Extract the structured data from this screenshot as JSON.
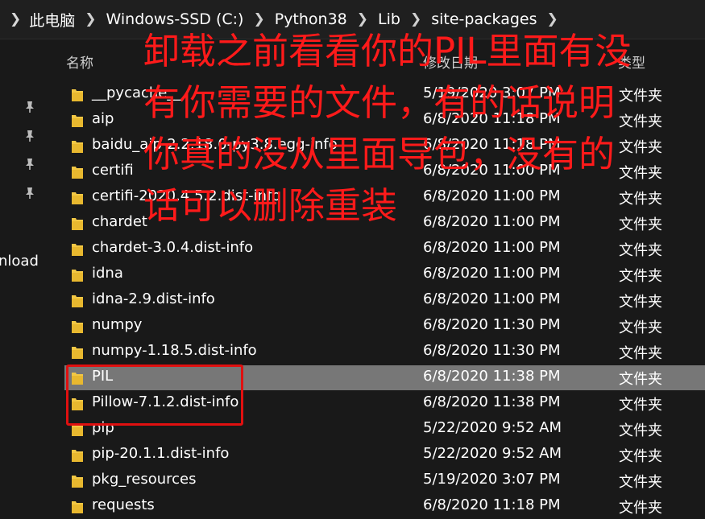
{
  "breadcrumb": {
    "items": [
      "此电脑",
      "Windows-SSD (C:)",
      "Python38",
      "Lib",
      "site-packages"
    ]
  },
  "columns": {
    "name": "名称",
    "modified": "修改日期",
    "type": "类型"
  },
  "nav": {
    "label": "nload"
  },
  "files": [
    {
      "name": "__pycache__",
      "date": "5/19/2020 3:07 PM",
      "type": "文件夹"
    },
    {
      "name": "aip",
      "date": "6/8/2020 11:18 PM",
      "type": "文件夹"
    },
    {
      "name": "baidu_aip-2.2.18.0-py3.8.egg-info",
      "date": "6/8/2020 11:18 PM",
      "type": "文件夹"
    },
    {
      "name": "certifi",
      "date": "6/8/2020 11:00 PM",
      "type": "文件夹"
    },
    {
      "name": "certifi-2020.4.5.2.dist-info",
      "date": "6/8/2020 11:00 PM",
      "type": "文件夹"
    },
    {
      "name": "chardet",
      "date": "6/8/2020 11:00 PM",
      "type": "文件夹"
    },
    {
      "name": "chardet-3.0.4.dist-info",
      "date": "6/8/2020 11:00 PM",
      "type": "文件夹"
    },
    {
      "name": "idna",
      "date": "6/8/2020 11:00 PM",
      "type": "文件夹"
    },
    {
      "name": "idna-2.9.dist-info",
      "date": "6/8/2020 11:00 PM",
      "type": "文件夹"
    },
    {
      "name": "numpy",
      "date": "6/8/2020 11:30 PM",
      "type": "文件夹"
    },
    {
      "name": "numpy-1.18.5.dist-info",
      "date": "6/8/2020 11:30 PM",
      "type": "文件夹"
    },
    {
      "name": "PIL",
      "date": "6/8/2020 11:38 PM",
      "type": "文件夹",
      "selected": true
    },
    {
      "name": "Pillow-7.1.2.dist-info",
      "date": "6/8/2020 11:38 PM",
      "type": "文件夹"
    },
    {
      "name": "pip",
      "date": "5/22/2020 9:52 AM",
      "type": "文件夹"
    },
    {
      "name": "pip-20.1.1.dist-info",
      "date": "5/22/2020 9:52 AM",
      "type": "文件夹"
    },
    {
      "name": "pkg_resources",
      "date": "5/19/2020 3:07 PM",
      "type": "文件夹"
    },
    {
      "name": "requests",
      "date": "6/8/2020 11:18 PM",
      "type": "文件夹"
    }
  ],
  "annotation": {
    "lines": [
      "卸载之前看看你的PIL里面有没",
      "有你需要的文件，有的话说明",
      "你真的没从里面导包，没有的",
      "话可以删除重装"
    ],
    "color": "#ff1a1a"
  },
  "colors": {
    "background": "#191919",
    "selected_row": "#777777",
    "folder": "#f2c744",
    "highlight_border": "#e01010"
  }
}
